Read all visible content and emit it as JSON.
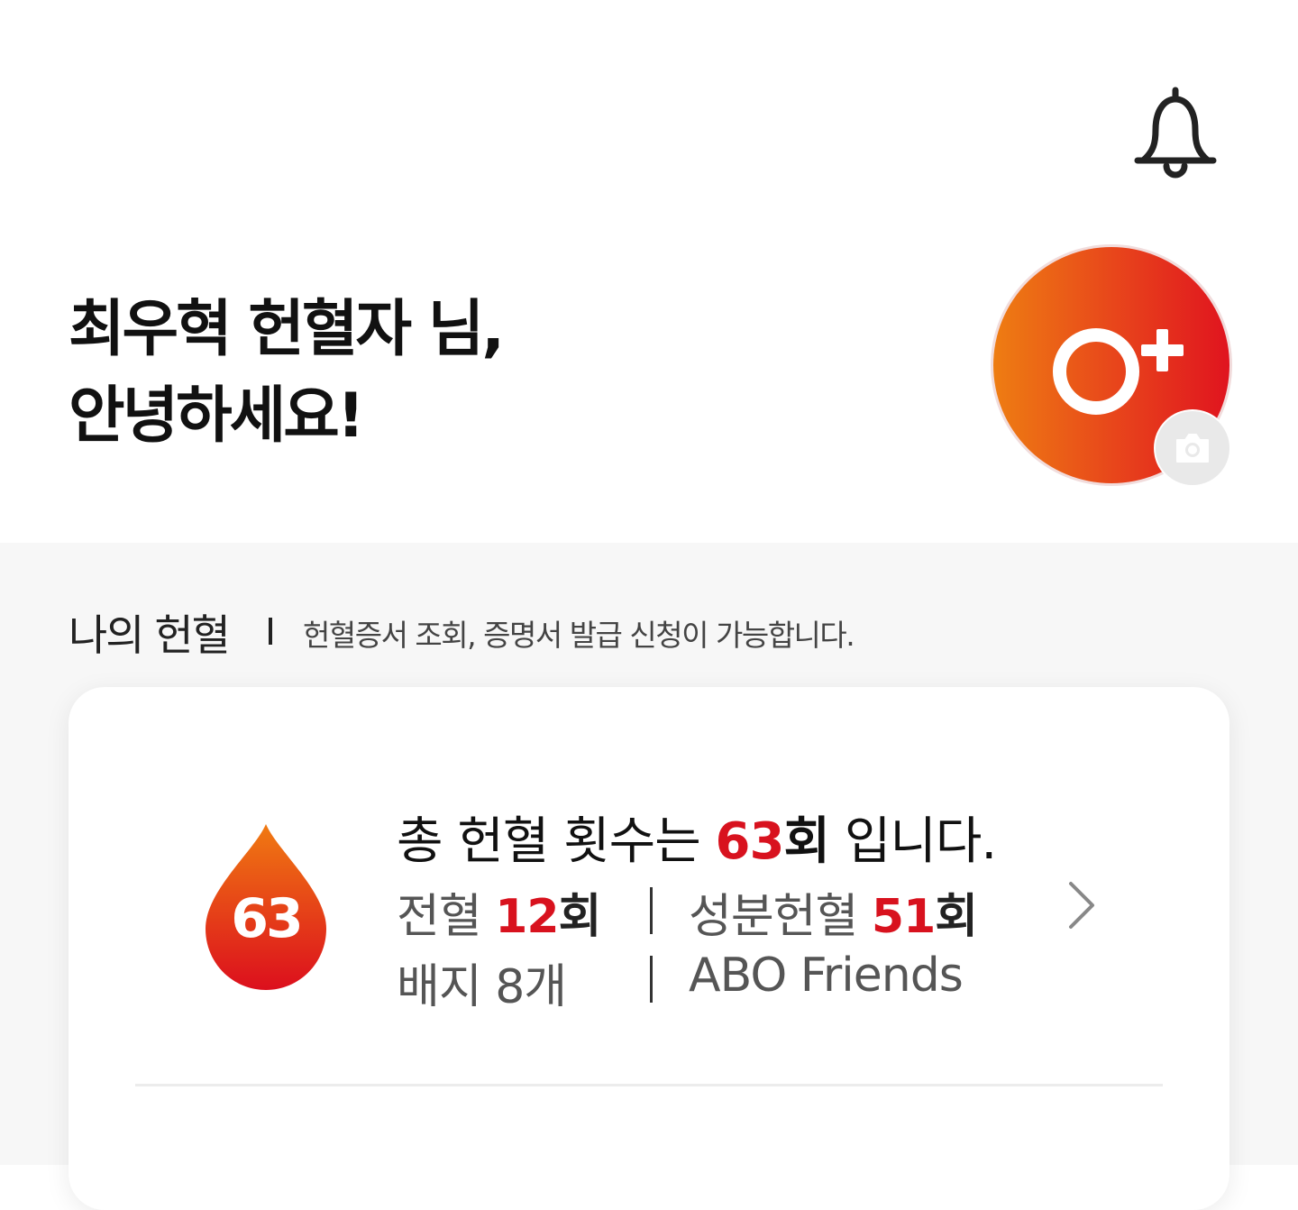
{
  "header": {
    "greeting_line1": "최우혁 헌혈자 님,",
    "greeting_line2": "안녕하세요!",
    "notification_icon": "bell-icon",
    "blood_type": "O+",
    "camera_icon": "camera-icon"
  },
  "section": {
    "title": "나의 헌혈",
    "description": "헌혈증서 조회, 증명서 발급 신청이 가능합니다."
  },
  "summary": {
    "drop_count": "63",
    "total_prefix": "총 헌혈 횟수는",
    "total_count": "63",
    "total_unit": "회",
    "total_suffix": "입니다.",
    "whole_label": "전혈",
    "whole_count": "12",
    "whole_unit": "회",
    "component_label": "성분헌혈",
    "component_count": "51",
    "component_unit": "회",
    "badge_text": "배지 8개",
    "friends_text": "ABO Friends"
  },
  "colors": {
    "accent_red": "#d8121e",
    "gradient_orange": "#ee7d12"
  }
}
